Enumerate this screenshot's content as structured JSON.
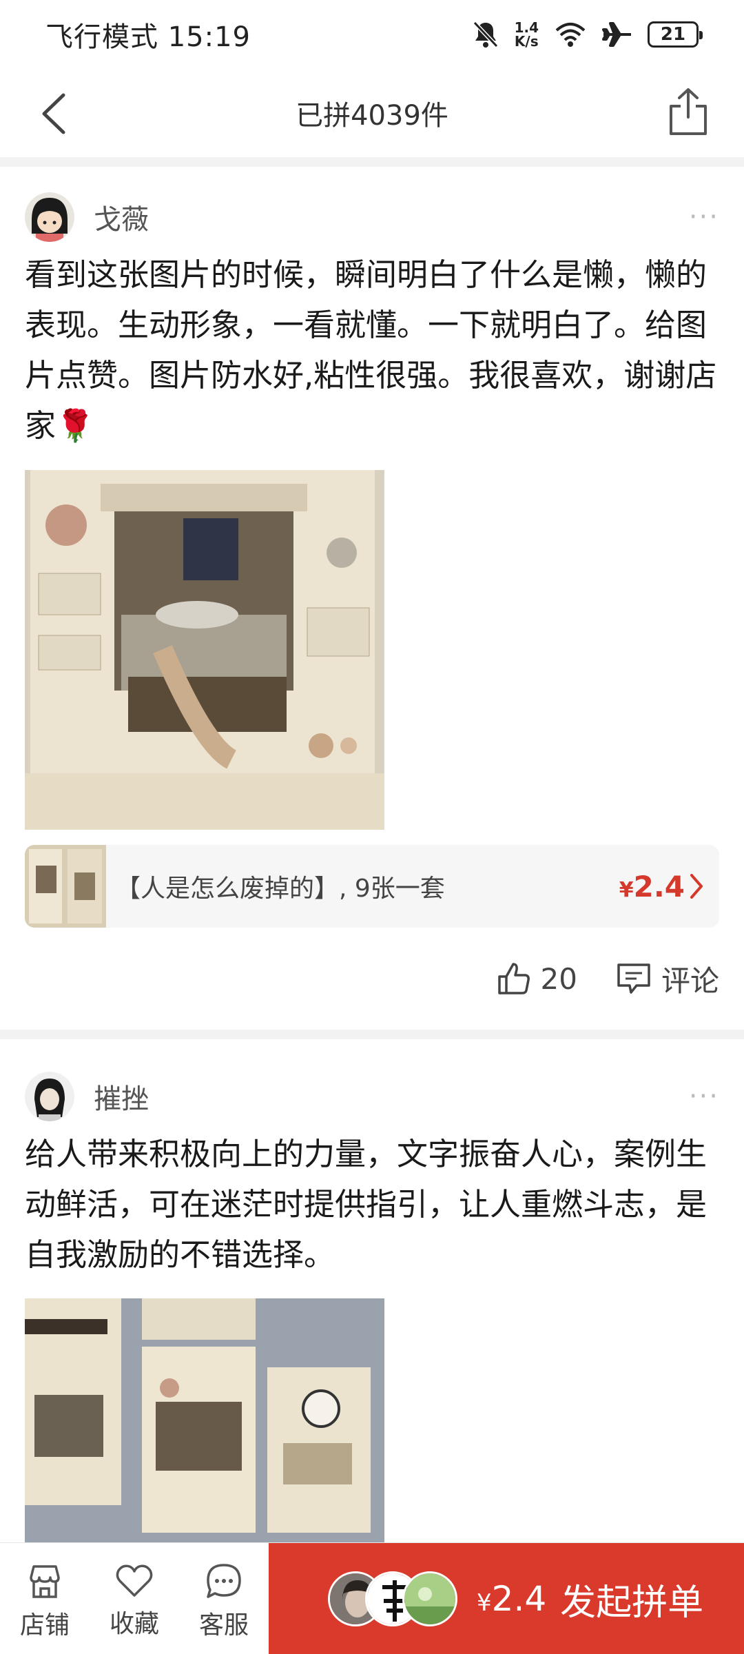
{
  "status_bar": {
    "left_text": "飞行模式 15:19",
    "net_speed_value": "1.4",
    "net_speed_unit": "K/s",
    "battery": "21"
  },
  "header": {
    "title": "已拼4039件",
    "back_icon": "back-icon",
    "share_icon": "share-icon"
  },
  "reviews": [
    {
      "username": "戈薇",
      "text": "看到这张图片的时候，瞬间明白了什么是懒，懒的表现。生动形象，一看就懂。一下就明白了。给图片点赞。图片防水好,粘性很强。我很喜欢，谢谢店家🌹",
      "more": "···",
      "product": {
        "title": "【人是怎么废掉的】, 9张一套",
        "price_symbol": "¥",
        "price": "2.4"
      },
      "likes": "20",
      "comment_label": "评论"
    },
    {
      "username": "摧挫",
      "text": "给人带来积极向上的力量，文字振奋人心，案例生动鲜活，可在迷茫时提供指引，让人重燃斗志，是自我激励的不错选择。",
      "more": "···"
    }
  ],
  "bottom_bar": {
    "store_label": "店铺",
    "favorite_label": "收藏",
    "service_label": "客服",
    "group_price_symbol": "¥",
    "group_price": "2.4",
    "group_label": "发起拼单"
  },
  "colors": {
    "accent": "#d93a2c",
    "price": "#d4392b",
    "separator": "#f2f2f2"
  }
}
